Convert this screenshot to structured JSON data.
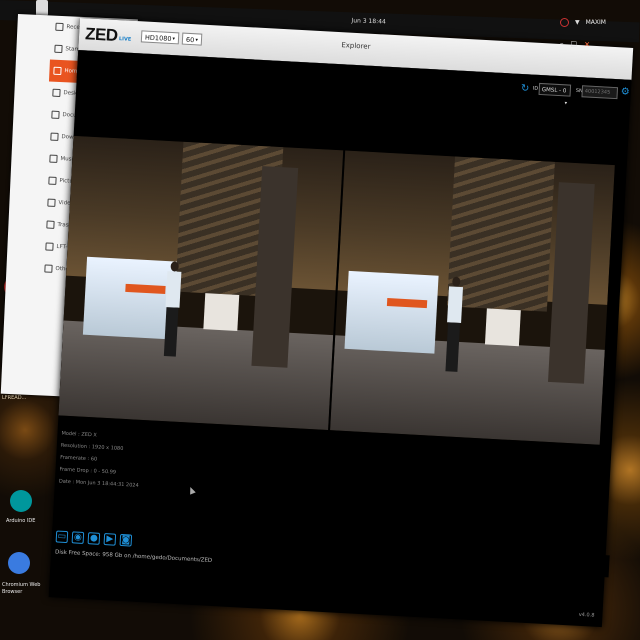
{
  "system": {
    "clock": "Jun 3  18:44",
    "user": "MAXIM",
    "dock_labels": [
      "LFREAD...",
      "Arduino IDE",
      "Chromium Web Browser"
    ]
  },
  "files": {
    "items": [
      {
        "label": "Recent",
        "icon": "clock-icon"
      },
      {
        "label": "Starred",
        "icon": "star-icon"
      },
      {
        "label": "Home",
        "icon": "home-icon",
        "active": true
      },
      {
        "label": "Desktop",
        "icon": "desktop-icon"
      },
      {
        "label": "Documents",
        "icon": "document-icon"
      },
      {
        "label": "Downloads",
        "icon": "download-icon"
      },
      {
        "label": "Music",
        "icon": "music-icon"
      },
      {
        "label": "Pictures",
        "icon": "picture-icon"
      },
      {
        "label": "Videos",
        "icon": "video-icon"
      },
      {
        "label": "Trash",
        "icon": "trash-icon"
      },
      {
        "label": "LFT-REA...",
        "icon": "drive-icon"
      },
      {
        "label": "Other Locations",
        "icon": "plus-icon"
      }
    ]
  },
  "zed": {
    "logo": "ZED",
    "live": "LIVE",
    "title": "Explorer",
    "resolution": "HD1080",
    "fps": "60",
    "id_label": "ID",
    "id_value": "GMSL - 0",
    "sn_label": "SN",
    "sn_placeholder": "40012345",
    "info": {
      "model": "Model : ZED X",
      "resolution": "Resolution : 1920 x 1080",
      "framerate": "Framerate : 60",
      "frame_drop": "Frame Drop : 0 - 50.99",
      "date": "Date : Mon Jun 3 18:44:31 2024"
    },
    "actions": [
      {
        "icon": "folder-icon"
      },
      {
        "icon": "live-stream-icon"
      },
      {
        "icon": "record-icon"
      },
      {
        "icon": "video-icon"
      },
      {
        "icon": "camera-icon"
      }
    ],
    "disk": "Disk Free Space: 958 Gb on /home/gedo/Documents/ZED",
    "version": "v4.0.8"
  },
  "colors": {
    "accent": "#1f8fd6",
    "files_active": "#e95420"
  }
}
